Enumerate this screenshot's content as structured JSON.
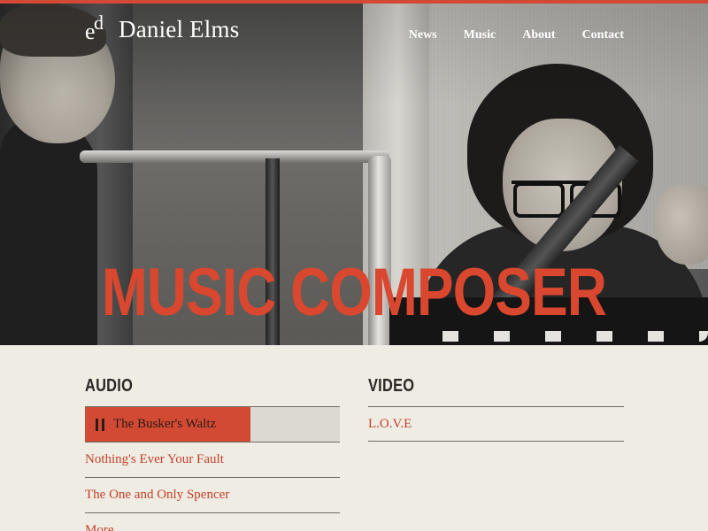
{
  "header": {
    "logo_text": "Daniel Elms",
    "nav": [
      "News",
      "Music",
      "About",
      "Contact"
    ]
  },
  "hero": {
    "title": "MUSIC COMPOSER"
  },
  "audio": {
    "heading": "AUDIO",
    "now_playing": {
      "label": "The Busker's Waltz",
      "progress": 0.65
    },
    "tracks": [
      "Nothing's Ever Your Fault",
      "The One and Only Spencer",
      "More"
    ]
  },
  "video": {
    "heading": "VIDEO",
    "items": [
      "L.O.V.E"
    ]
  },
  "colors": {
    "accent": "#d24a33",
    "background": "#efece4",
    "text_dark": "#2a2724"
  }
}
